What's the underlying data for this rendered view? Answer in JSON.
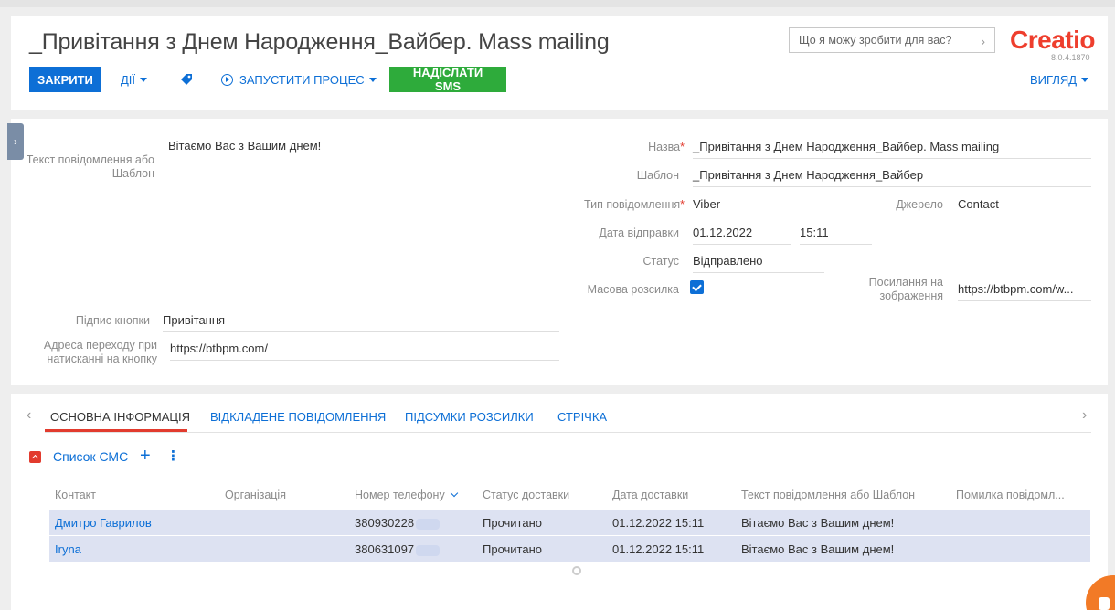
{
  "header": {
    "title": "_Привітання з Днем Народження_Вайбер. Mass mailing",
    "close_label": "ЗАКРИТИ",
    "actions_label": "ДІЇ",
    "run_process_label": "ЗАПУСТИТИ ПРОЦЕС",
    "send_sms_label": "НАДІСЛАТИ SMS",
    "view_label": "ВИГЛЯД",
    "search_placeholder": "Що я можу зробити для вас?",
    "logo": "Creatio",
    "version": "8.0.4.1870"
  },
  "form": {
    "message_text_label": "Текст повідомлення або Шаблон",
    "message_text_value": "Вітаємо Вас з Вашим днем!",
    "button_caption_label": "Підпис кнопки",
    "button_caption_value": "Привітання",
    "button_url_label": "Адреса переходу при натисканні на кнопку",
    "button_url_value": "https://btbpm.com/",
    "name_label": "Назва",
    "name_value": "_Привітання з Днем Народження_Вайбер. Mass mailing",
    "template_label": "Шаблон",
    "template_value": "_Привітання з Днем Народження_Вайбер",
    "message_type_label": "Тип повідомлення",
    "message_type_value": "Viber",
    "source_label": "Джерело",
    "source_value": "Contact",
    "send_date_label": "Дата відправки",
    "send_date_value": "01.12.2022",
    "send_time_value": "15:11",
    "status_label": "Статус",
    "status_value": "Відправлено",
    "mass_mailing_label": "Масова розсилка",
    "mass_mailing_checked": true,
    "image_link_label": "Посилання на зображення",
    "image_link_value": "https://btbpm.com/w..."
  },
  "tabs": [
    {
      "label": "ОСНОВНА ІНФОРМАЦІЯ",
      "active": true
    },
    {
      "label": "ВІДКЛАДЕНЕ ПОВІДОМЛЕННЯ",
      "active": false
    },
    {
      "label": "ПІДСУМКИ РОЗСИЛКИ",
      "active": false
    },
    {
      "label": "СТРІЧКА",
      "active": false
    }
  ],
  "sms_list": {
    "title": "Список СМС",
    "columns": [
      "Контакт",
      "Організація",
      "Номер телефону",
      "Статус доставки",
      "Дата доставки",
      "Текст повідомлення або Шаблон",
      "Помилка повідомл..."
    ],
    "rows": [
      {
        "contact": "Дмитро Гаврилов",
        "organization": "",
        "phone": "380930228",
        "delivery_status": "Прочитано",
        "delivery_date": "01.12.2022 15:11",
        "message": "Вітаємо Вас з Вашим днем!",
        "error": ""
      },
      {
        "contact": "Iryna",
        "organization": "",
        "phone": "380631097",
        "delivery_status": "Прочитано",
        "delivery_date": "01.12.2022 15:11",
        "message": "Вітаємо Вас з Вашим днем!",
        "error": ""
      }
    ]
  },
  "colors": {
    "primary": "#0d6fd6",
    "success": "#2eab3b",
    "brand": "#ee3e2d",
    "required": "#e23b2e",
    "row_highlight": "#dde2f2"
  }
}
